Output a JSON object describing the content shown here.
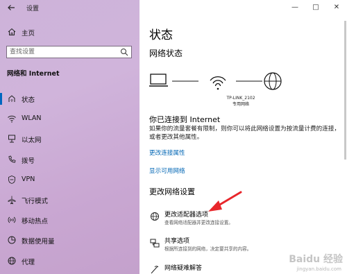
{
  "window": {
    "title": "设置",
    "minimize": "—",
    "maximize": "□",
    "close": "✕"
  },
  "sidebar": {
    "home_label": "主页",
    "search_placeholder": "查找设置",
    "section_title": "网络和 Internet",
    "items": [
      {
        "label": "状态",
        "icon": "home-network-icon",
        "active": true
      },
      {
        "label": "WLAN",
        "icon": "wifi-icon"
      },
      {
        "label": "以太网",
        "icon": "ethernet-icon"
      },
      {
        "label": "拨号",
        "icon": "dialup-icon"
      },
      {
        "label": "VPN",
        "icon": "vpn-icon"
      },
      {
        "label": "飞行模式",
        "icon": "airplane-icon"
      },
      {
        "label": "移动热点",
        "icon": "hotspot-icon"
      },
      {
        "label": "数据使用量",
        "icon": "data-usage-icon"
      },
      {
        "label": "代理",
        "icon": "globe-icon"
      }
    ]
  },
  "main": {
    "title": "状态",
    "network_status_heading": "网络状态",
    "network_name": "TP-LINK_2102",
    "network_type": "专用网络",
    "connected_title": "你已连接到 Internet",
    "connected_desc": "如果你的流量套餐有限制，则你可以将此网络设置为按流量计费的连接，或者更改其他属性。",
    "link_change_props": "更改连接属性",
    "link_show_networks": "显示可用网络",
    "change_settings_heading": "更改网络设置",
    "options": [
      {
        "title": "更改适配器选项",
        "desc": "查看网络适配器并更改连接设置。",
        "icon": "adapter-icon"
      },
      {
        "title": "共享选项",
        "desc": "根据所连接到的网络，决定要共享的内容。",
        "icon": "sharing-icon"
      },
      {
        "title": "网络疑难解答",
        "desc": "",
        "icon": "troubleshoot-icon"
      }
    ]
  },
  "watermark": {
    "text": "Baidu 经验",
    "url": "jingyan.baidu.com"
  },
  "colors": {
    "accent": "#0067c0",
    "link": "#0066b4",
    "arrow": "#e8262b",
    "sidebar": "#cdb3d9"
  }
}
